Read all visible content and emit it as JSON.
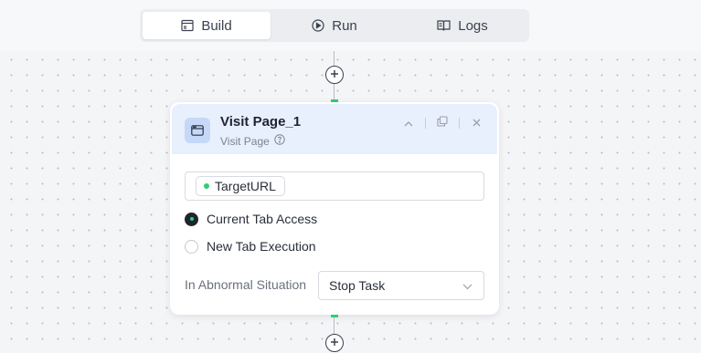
{
  "tabs": [
    {
      "label": "Build",
      "icon": "build-icon",
      "active": true
    },
    {
      "label": "Run",
      "icon": "play-icon",
      "active": false
    },
    {
      "label": "Logs",
      "icon": "book-icon",
      "active": false
    }
  ],
  "node": {
    "title": "Visit Page_1",
    "subtitle": "Visit Page",
    "url_variable": "TargetURL",
    "options": [
      {
        "label": "Current Tab Access",
        "checked": true
      },
      {
        "label": "New Tab Execution",
        "checked": false
      }
    ],
    "abnormal_label": "In Abnormal Situation",
    "abnormal_value": "Stop Task"
  },
  "colors": {
    "accent_green": "#2fcf72",
    "header_bg": "#e8f0fd",
    "icon_bg": "#c6d8f8"
  }
}
